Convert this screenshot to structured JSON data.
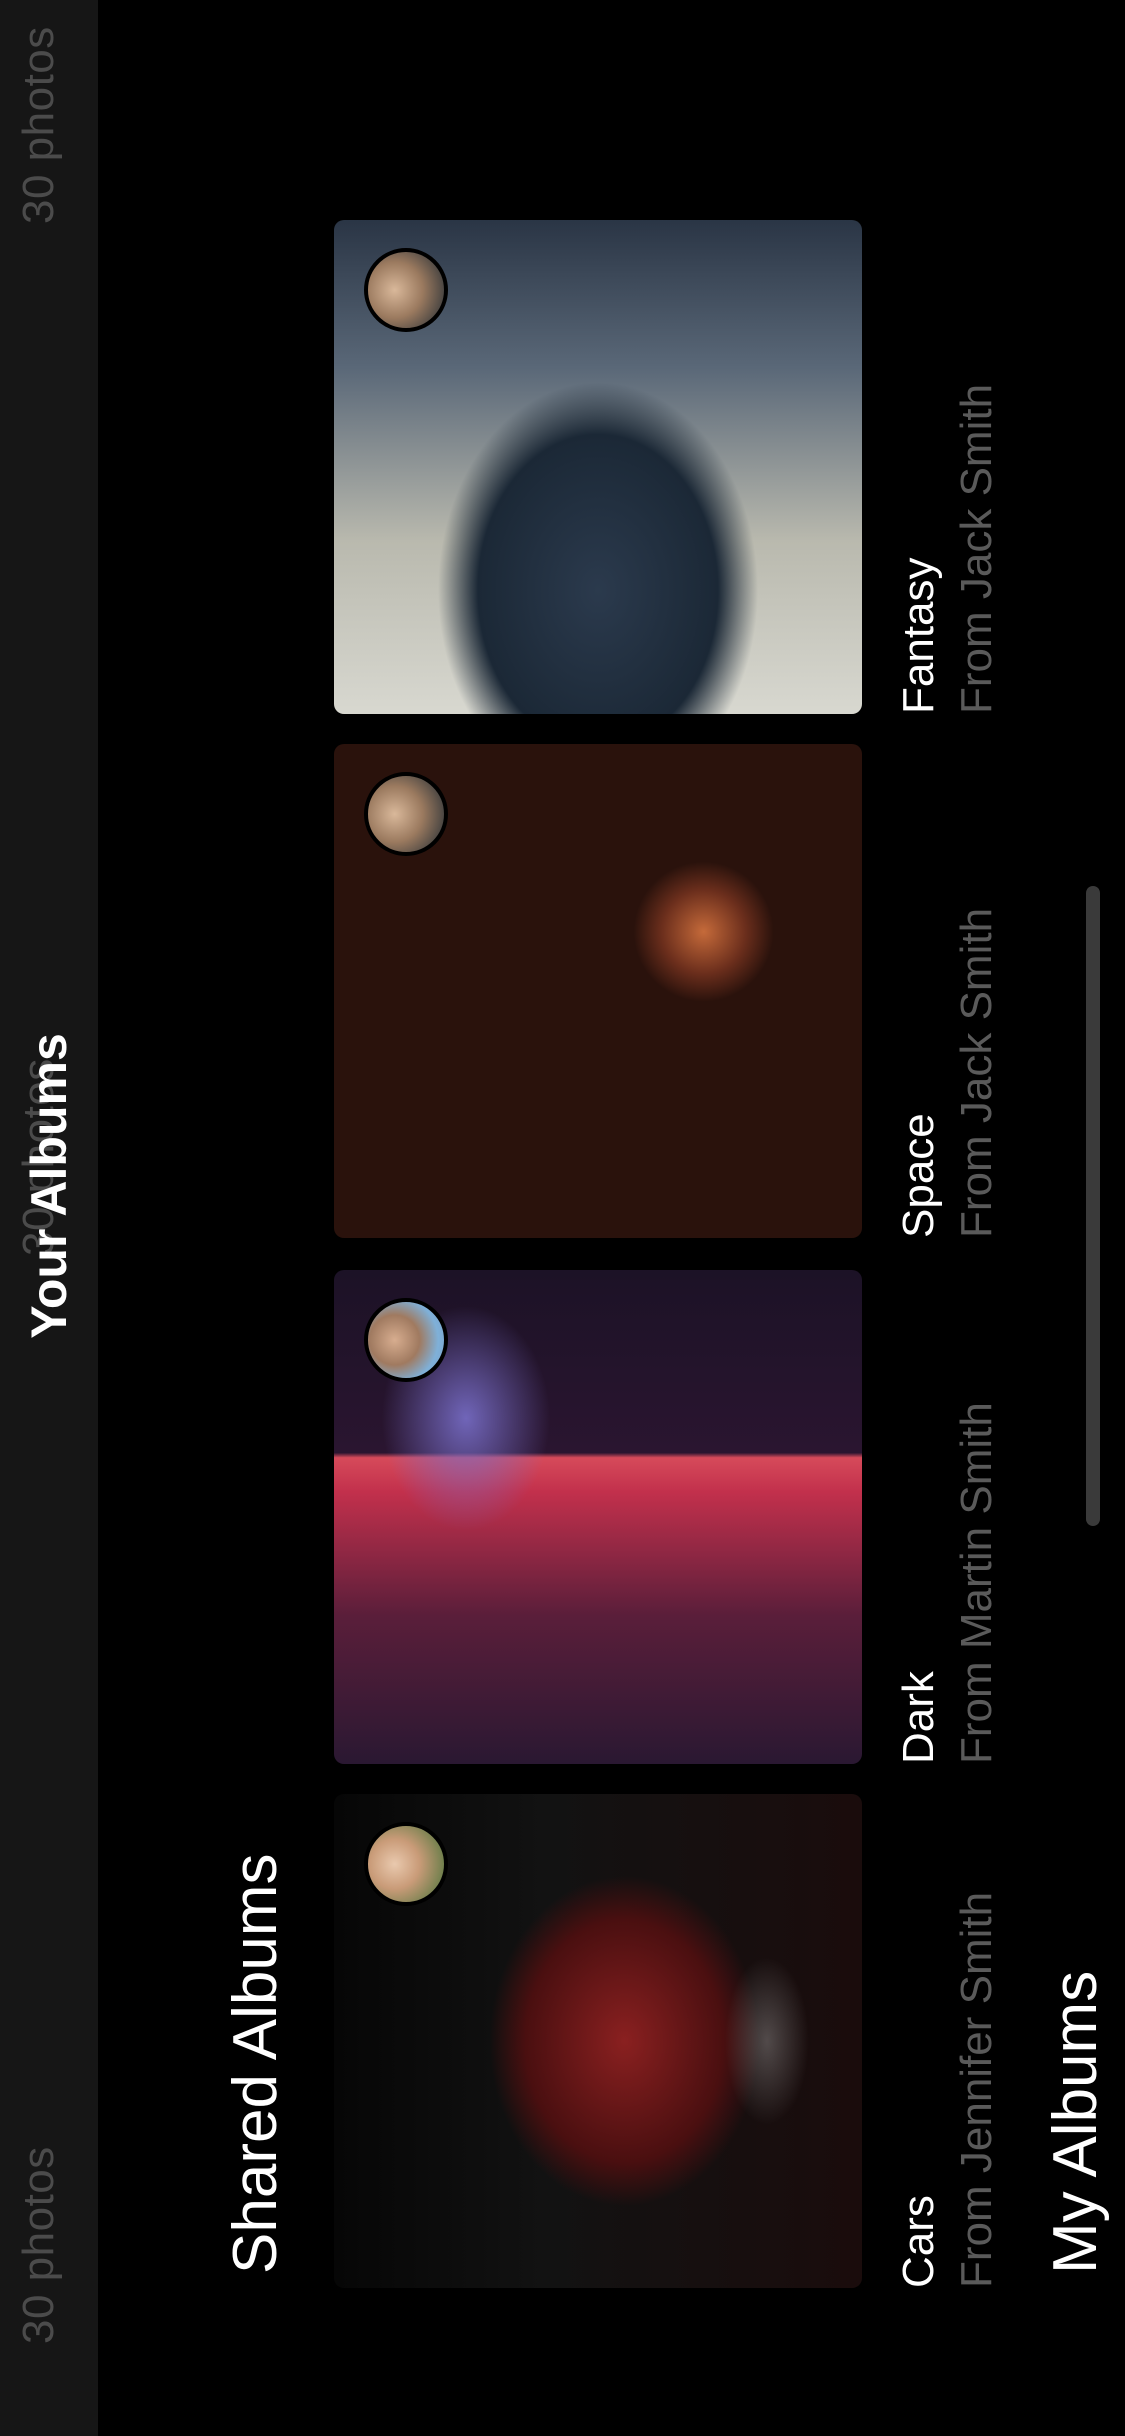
{
  "header": {
    "title": "Your Albums",
    "photo_count_center": "30 photos",
    "photo_count_left": "30 photos",
    "photo_count_right": "30 photos"
  },
  "sections": {
    "shared_title": "Shared Albums",
    "my_title": "My Albums"
  },
  "shared_albums": [
    {
      "name": "Cars",
      "from": "From Jennifer Smith",
      "avatar": "jennifer-avatar",
      "artwork": "red-car-photo"
    },
    {
      "name": "Dark",
      "from": "From Martin Smith",
      "avatar": "martin-avatar",
      "artwork": "smoke-silhouette-photo"
    },
    {
      "name": "Space",
      "from": "From Jack Smith",
      "avatar": "jack-avatar",
      "artwork": "planet-photo"
    },
    {
      "name": "Fantasy",
      "from": "From Jack Smith",
      "avatar": "jack-avatar",
      "artwork": "dragon-photo"
    }
  ]
}
